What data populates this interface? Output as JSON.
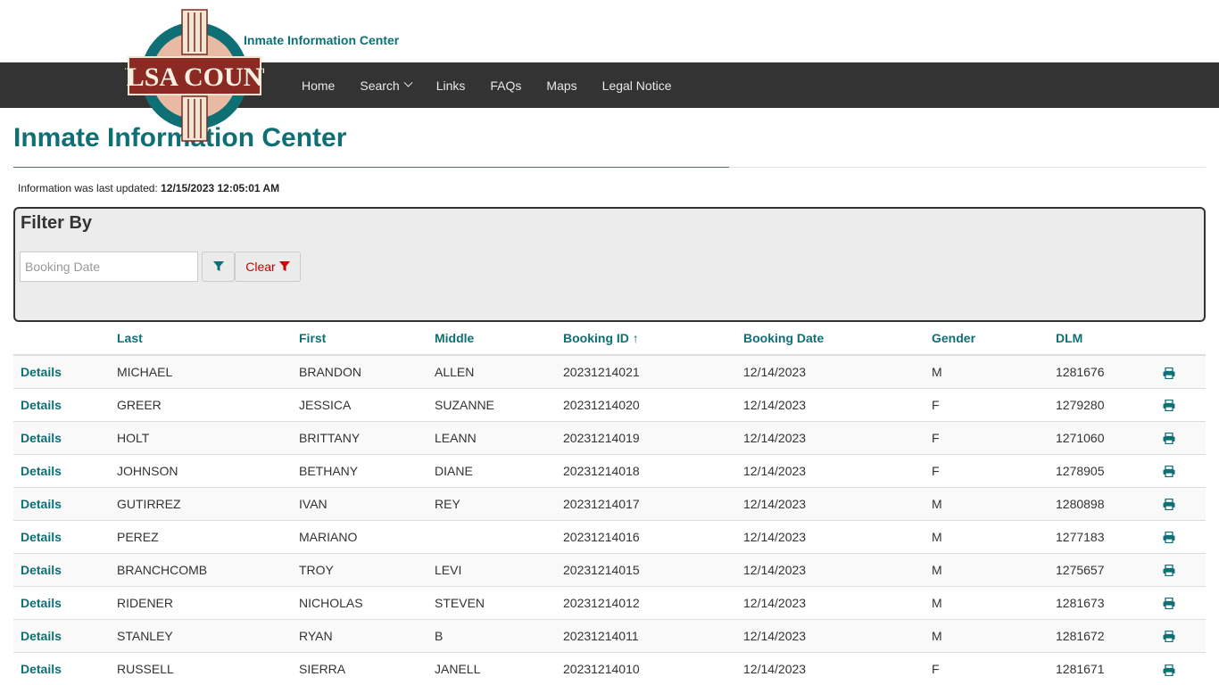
{
  "header": {
    "logo_text": "TULSA COUNTY",
    "site_subtitle": "Inmate Information Center"
  },
  "nav": {
    "items": [
      {
        "label": "Home"
      },
      {
        "label": "Search",
        "dropdown": true
      },
      {
        "label": "Links"
      },
      {
        "label": "FAQs"
      },
      {
        "label": "Maps"
      },
      {
        "label": "Legal Notice"
      }
    ]
  },
  "page": {
    "title": "Inmate Information Center",
    "updated_prefix": "Information was last updated:",
    "updated_value": "12/15/2023 12:05:01 AM"
  },
  "filter": {
    "heading": "Filter By",
    "booking_date_placeholder": "Booking Date",
    "filter_icon": "filter-icon",
    "clear_label": "Clear"
  },
  "table": {
    "columns": [
      "",
      "Last",
      "First",
      "Middle",
      "Booking ID ↑",
      "Booking Date",
      "Gender",
      "DLM",
      ""
    ],
    "details_label": "Details",
    "rows": [
      {
        "last": "MICHAEL",
        "first": "BRANDON",
        "middle": "ALLEN",
        "booking_id": "20231214021",
        "booking_date": "12/14/2023",
        "gender": "M",
        "dlm": "1281676"
      },
      {
        "last": "GREER",
        "first": "JESSICA",
        "middle": "SUZANNE",
        "booking_id": "20231214020",
        "booking_date": "12/14/2023",
        "gender": "F",
        "dlm": "1279280"
      },
      {
        "last": "HOLT",
        "first": "BRITTANY",
        "middle": "LEANN",
        "booking_id": "20231214019",
        "booking_date": "12/14/2023",
        "gender": "F",
        "dlm": "1271060"
      },
      {
        "last": "JOHNSON",
        "first": "BETHANY",
        "middle": "DIANE",
        "booking_id": "20231214018",
        "booking_date": "12/14/2023",
        "gender": "F",
        "dlm": "1278905"
      },
      {
        "last": "GUTIRREZ",
        "first": "IVAN",
        "middle": "REY",
        "booking_id": "20231214017",
        "booking_date": "12/14/2023",
        "gender": "M",
        "dlm": "1280898"
      },
      {
        "last": "PEREZ",
        "first": "MARIANO",
        "middle": "",
        "booking_id": "20231214016",
        "booking_date": "12/14/2023",
        "gender": "M",
        "dlm": "1277183"
      },
      {
        "last": "BRANCHCOMB",
        "first": "TROY",
        "middle": "LEVI",
        "booking_id": "20231214015",
        "booking_date": "12/14/2023",
        "gender": "M",
        "dlm": "1275657"
      },
      {
        "last": "RIDENER",
        "first": "NICHOLAS",
        "middle": "STEVEN",
        "booking_id": "20231214012",
        "booking_date": "12/14/2023",
        "gender": "M",
        "dlm": "1281673"
      },
      {
        "last": "STANLEY",
        "first": "RYAN",
        "middle": "B",
        "booking_id": "20231214011",
        "booking_date": "12/14/2023",
        "gender": "M",
        "dlm": "1281672"
      },
      {
        "last": "RUSSELL",
        "first": "SIERRA",
        "middle": "JANELL",
        "booking_id": "20231214010",
        "booking_date": "12/14/2023",
        "gender": "F",
        "dlm": "1281671"
      }
    ]
  },
  "colors": {
    "teal": "#0e6f74",
    "navbar": "#333333",
    "clear_red": "#cc0000",
    "rule": "#a0522d"
  }
}
